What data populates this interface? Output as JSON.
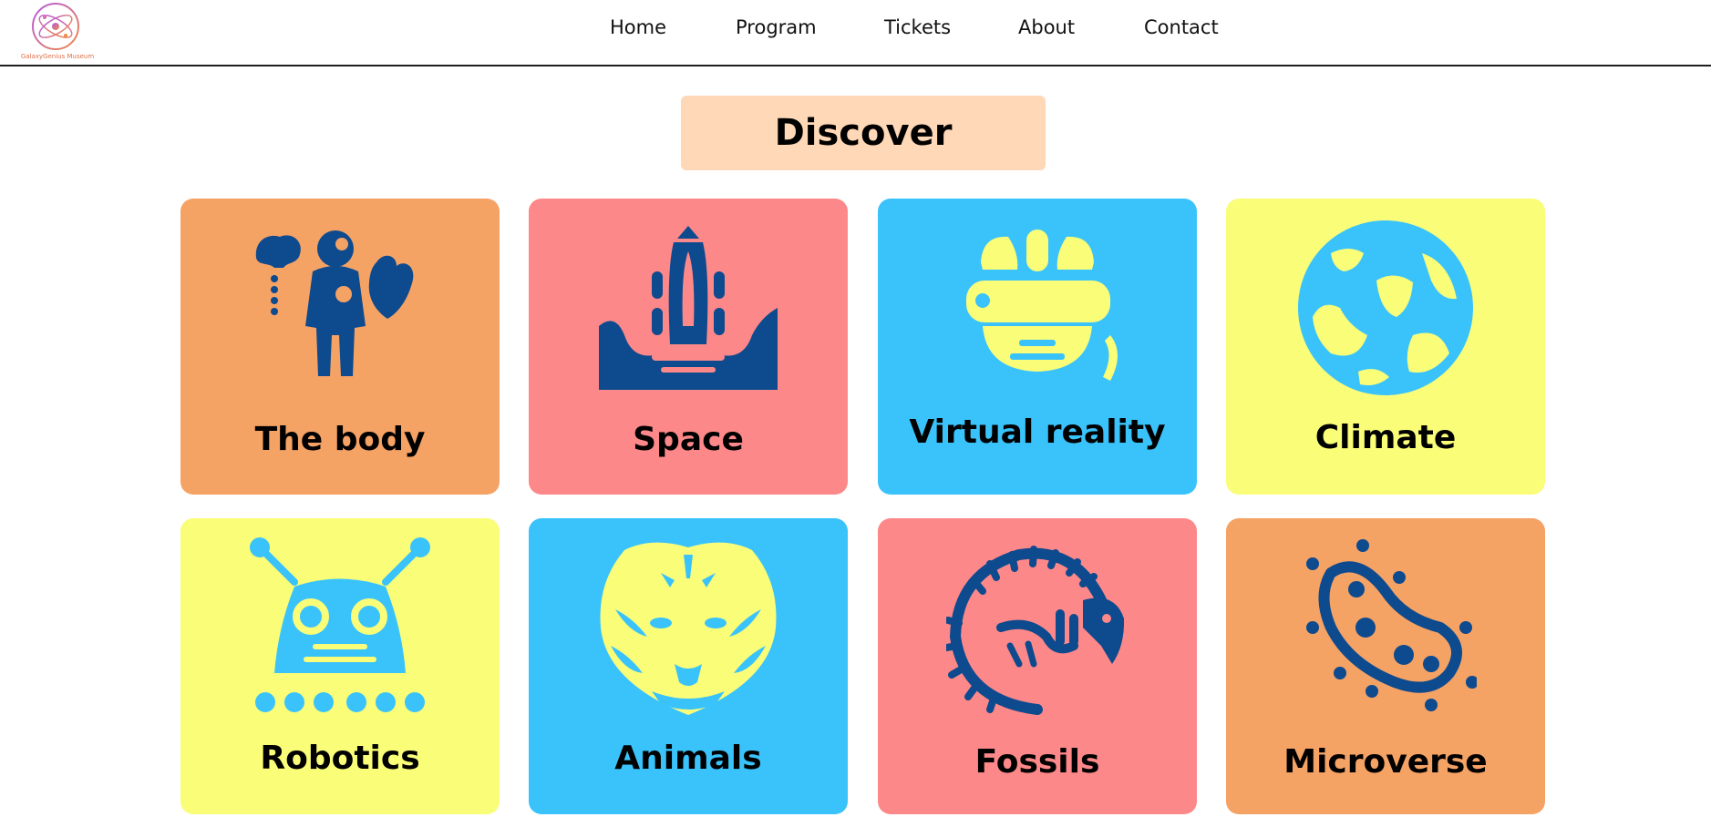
{
  "brand": {
    "name": "GalaxyGenius Museum",
    "logo_icon": "atom-galaxy-logo-icon"
  },
  "nav": {
    "items": [
      {
        "label": "Home"
      },
      {
        "label": "Program"
      },
      {
        "label": "Tickets"
      },
      {
        "label": "About"
      },
      {
        "label": "Contact"
      }
    ]
  },
  "section": {
    "title": "Discover"
  },
  "cards": [
    {
      "label": "The body",
      "icon": "human-body-icon",
      "color": "#f5a265"
    },
    {
      "label": "Space",
      "icon": "space-shuttle-icon",
      "color": "#fd8889"
    },
    {
      "label": "Virtual reality",
      "icon": "vr-headset-icon",
      "color": "#3ac3fb"
    },
    {
      "label": "Climate",
      "icon": "earth-globe-icon",
      "color": "#fafd78"
    },
    {
      "label": "Robotics",
      "icon": "robot-icon",
      "color": "#fafd78"
    },
    {
      "label": "Animals",
      "icon": "tiger-icon",
      "color": "#3ac3fb"
    },
    {
      "label": "Fossils",
      "icon": "dinosaur-fossil-icon",
      "color": "#fd8889"
    },
    {
      "label": "Microverse",
      "icon": "bacteria-icon",
      "color": "#f5a265"
    }
  ],
  "colors": {
    "navy": "#0d4a8e",
    "orange": "#f5a265",
    "pink": "#fd8889",
    "blue": "#3ac3fb",
    "yellow": "#fafd78",
    "discover_bg": "#fed8b7"
  }
}
